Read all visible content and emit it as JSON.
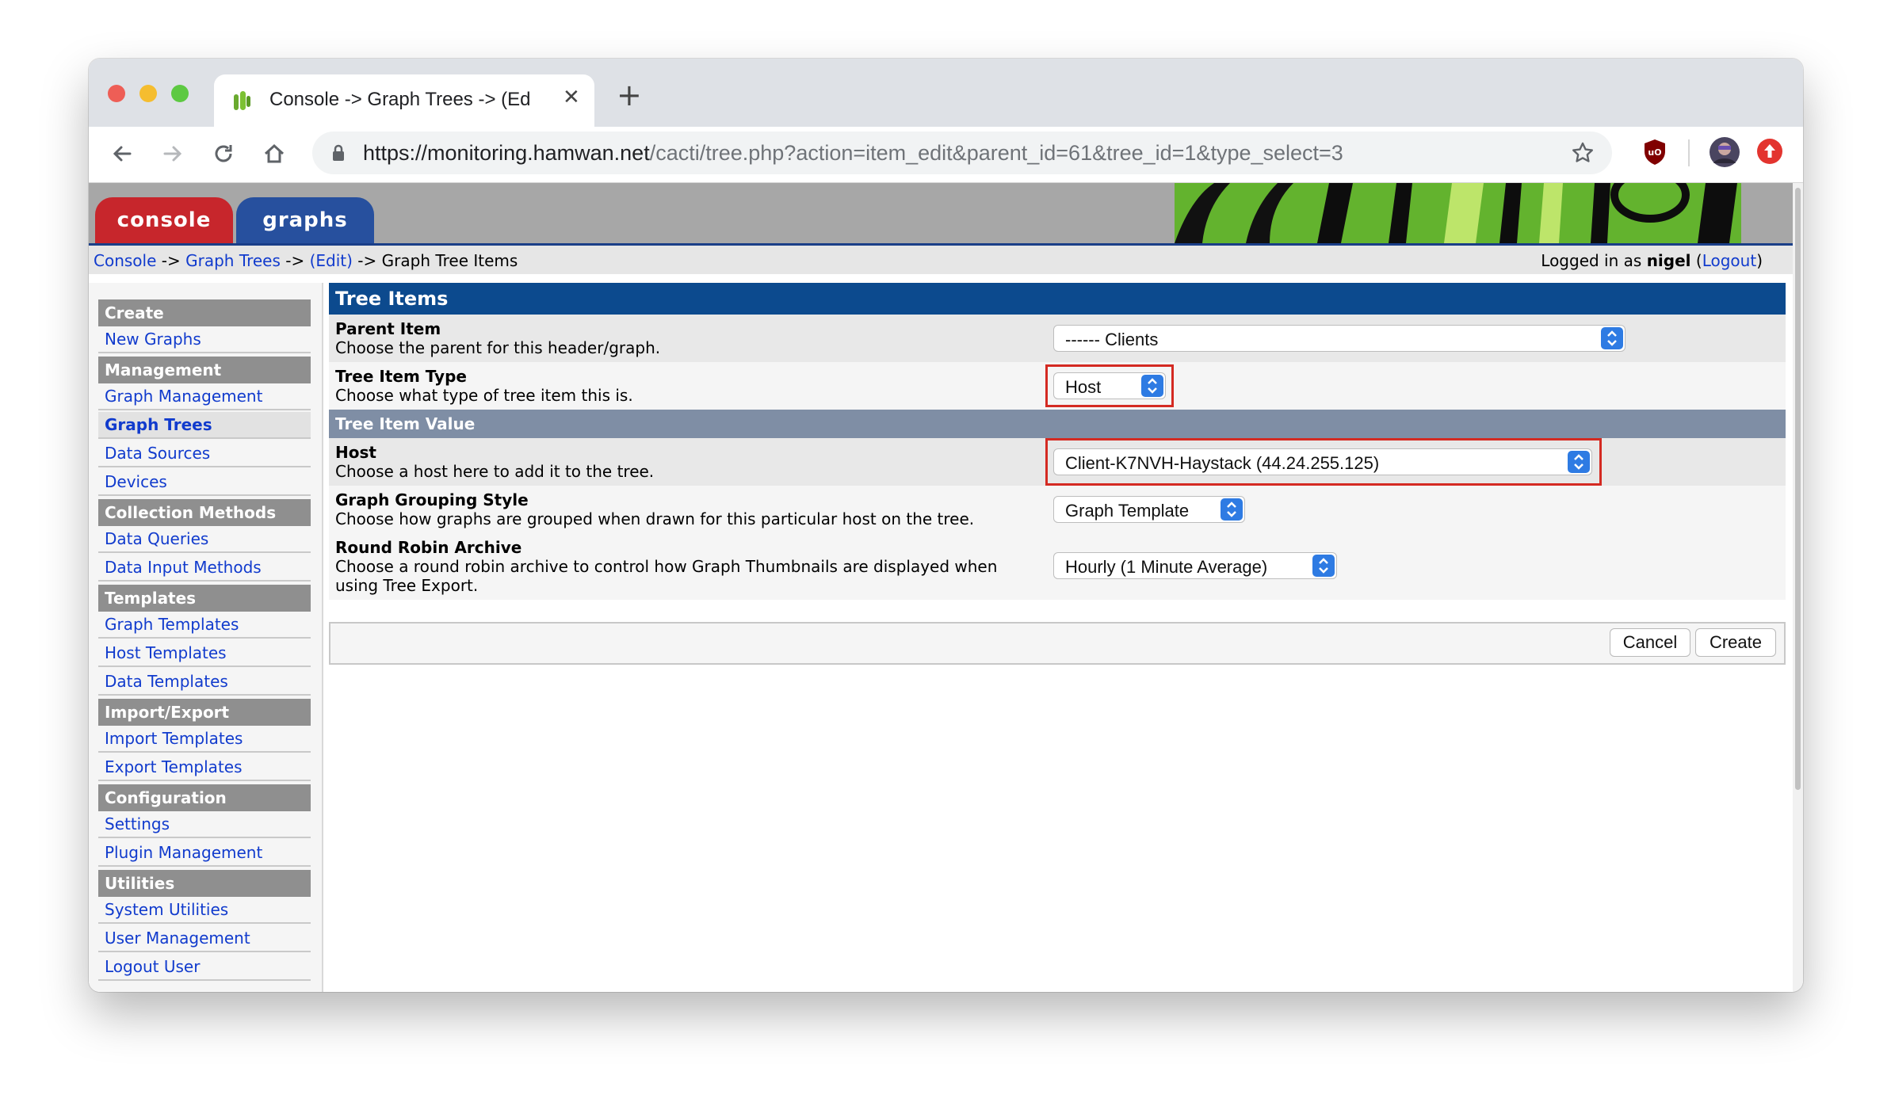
{
  "browser": {
    "tab_title": "Console -> Graph Trees -> (Ed",
    "url_host": "https://monitoring.hamwan.net",
    "url_path": "/cacti/tree.php?action=item_edit&parent_id=61&tree_id=1&type_select=3",
    "icons": [
      "back-icon",
      "forward-icon",
      "reload-icon",
      "home-icon",
      "lock-icon",
      "bookmark-star-icon",
      "ublock-icon",
      "profile-avatar-icon",
      "update-icon"
    ]
  },
  "top_tabs": {
    "console": "console",
    "graphs": "graphs"
  },
  "breadcrumb": {
    "console": "Console",
    "sep1": " -> ",
    "graph_trees": "Graph Trees",
    "sep2": " -> ",
    "edit": "(Edit)",
    "sep3": " -> ",
    "current": "Graph Tree Items"
  },
  "login": {
    "prefix": "Logged in as ",
    "user": "nigel",
    "open": " (",
    "logout": "Logout",
    "close": ")"
  },
  "sidebar": {
    "create_header": "Create",
    "new_graphs": "New Graphs",
    "management_header": "Management",
    "graph_management": "Graph Management",
    "graph_trees": "Graph Trees",
    "data_sources": "Data Sources",
    "devices": "Devices",
    "collection_header": "Collection Methods",
    "data_queries": "Data Queries",
    "data_input_methods": "Data Input Methods",
    "templates_header": "Templates",
    "graph_templates": "Graph Templates",
    "host_templates": "Host Templates",
    "data_templates": "Data Templates",
    "import_export_header": "Import/Export",
    "import_templates": "Import Templates",
    "export_templates": "Export Templates",
    "configuration_header": "Configuration",
    "settings": "Settings",
    "plugin_management": "Plugin Management",
    "utilities_header": "Utilities",
    "system_utilities": "System Utilities",
    "user_management": "User Management",
    "logout_user": "Logout User"
  },
  "form": {
    "title": "Tree Items",
    "parent_item": {
      "label": "Parent Item",
      "desc": "Choose the parent for this header/graph.",
      "value": "------ Clients"
    },
    "tree_item_type": {
      "label": "Tree Item Type",
      "desc": "Choose what type of tree item this is.",
      "value": "Host"
    },
    "value_header": "Tree Item Value",
    "host": {
      "label": "Host",
      "desc": "Choose a host here to add it to the tree.",
      "value": "Client-K7NVH-Haystack (44.24.255.125)"
    },
    "grouping": {
      "label": "Graph Grouping Style",
      "desc": "Choose how graphs are grouped when drawn for this particular host on the tree.",
      "value": "Graph Template"
    },
    "rra": {
      "label": "Round Robin Archive",
      "desc_line1": "Choose a round robin archive to control how Graph Thumbnails are displayed when",
      "desc_line2": "using Tree Export.",
      "value": "Hourly (1 Minute Average)"
    },
    "cancel": "Cancel",
    "create": "Create"
  }
}
